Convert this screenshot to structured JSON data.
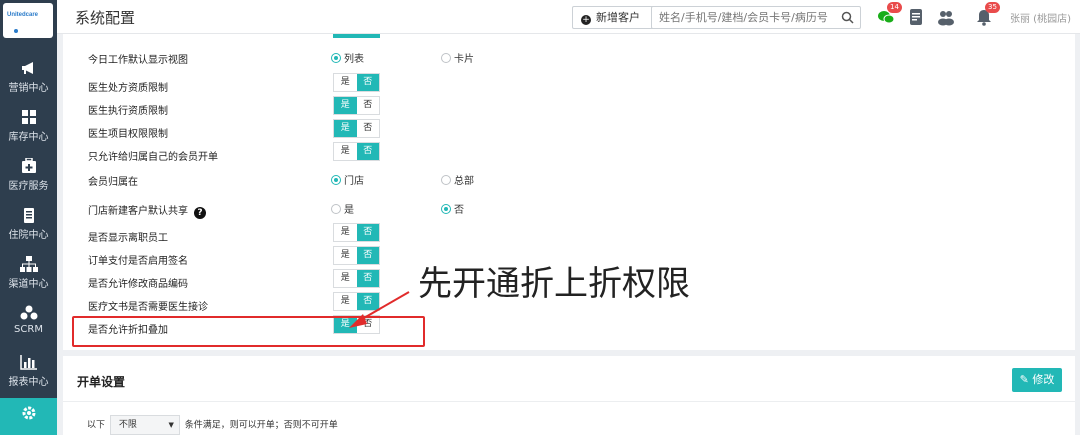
{
  "logo": {
    "text": "Unitedcare"
  },
  "sidebar": {
    "cut_label": "",
    "items": [
      {
        "label": "营销中心",
        "icon": "megaphone-icon"
      },
      {
        "label": "库存中心",
        "icon": "grid-icon"
      },
      {
        "label": "医疗服务",
        "icon": "medical-kit-icon"
      },
      {
        "label": "住院中心",
        "icon": "clipboard-icon"
      },
      {
        "label": "渠道中心",
        "icon": "org-chart-icon"
      },
      {
        "label": "SCRM",
        "icon": "users-icon"
      },
      {
        "label": "报表中心",
        "icon": "bar-chart-icon"
      },
      {
        "label": "",
        "icon": "gear-icon"
      }
    ]
  },
  "header": {
    "title": "系统配置",
    "new_customer": "新增客户",
    "search_placeholder": "姓名/手机号/建档/会员卡号/病历号",
    "wechat_badge": "14",
    "bell_badge": "35",
    "user": "张丽 (桃园店)"
  },
  "settings": {
    "r0": {
      "label": "今日工作默认显示视图",
      "opt1": "列表",
      "opt2": "卡片"
    },
    "r1": {
      "label": "医生处方资质限制",
      "yes": "是",
      "no": "否"
    },
    "r2": {
      "label": "医生执行资质限制",
      "yes": "是",
      "no": "否"
    },
    "r3": {
      "label": "医生项目权限限制",
      "yes": "是",
      "no": "否"
    },
    "r4": {
      "label": "只允许给归属自己的会员开单",
      "yes": "是",
      "no": "否"
    },
    "r5": {
      "label": "会员归属在",
      "opt1": "门店",
      "opt2": "总部"
    },
    "r6": {
      "label": "门店新建客户默认共享",
      "opt1": "是",
      "opt2": "否"
    },
    "r7": {
      "label": "是否显示离职员工",
      "yes": "是",
      "no": "否"
    },
    "r8": {
      "label": "订单支付是否启用签名",
      "yes": "是",
      "no": "否"
    },
    "r9": {
      "label": "是否允许修改商品编码",
      "yes": "是",
      "no": "否"
    },
    "r10": {
      "label": "医疗文书是否需要医生接诊",
      "yes": "是",
      "no": "否"
    },
    "r11": {
      "label": "是否允许折扣叠加",
      "yes": "是",
      "no": "否"
    }
  },
  "annotation": {
    "text": "先开通折上折权限"
  },
  "order": {
    "title": "开单设置",
    "edit": "修改",
    "cond_prefix": "以下",
    "select_value": "不限",
    "cond_suffix": "条件满足，则可以开单；否则不可开单"
  },
  "colors": {
    "accent": "#22b8b6",
    "sidebar": "#2e3e4e",
    "annotation": "#e12b2b"
  }
}
